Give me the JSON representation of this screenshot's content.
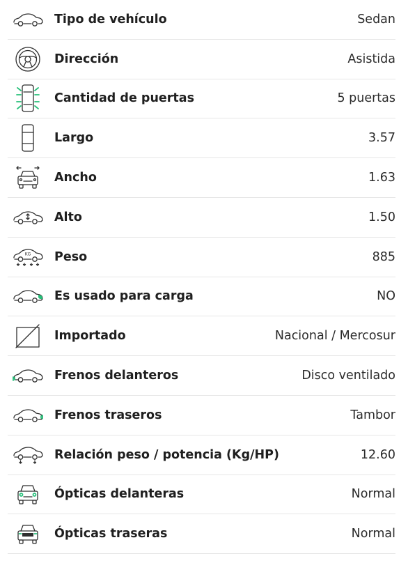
{
  "specs": [
    {
      "icon": "car-side-icon",
      "label": "Tipo de vehículo",
      "value": "Sedan"
    },
    {
      "icon": "steering-wheel-icon",
      "label": "Dirección",
      "value": "Asistida"
    },
    {
      "icon": "car-doors-icon",
      "label": "Cantidad de puertas",
      "value": "5 puertas"
    },
    {
      "icon": "car-length-icon",
      "label": "Largo",
      "value": "3.57"
    },
    {
      "icon": "car-width-icon",
      "label": "Ancho",
      "value": "1.63"
    },
    {
      "icon": "car-height-icon",
      "label": "Alto",
      "value": "1.50"
    },
    {
      "icon": "car-weight-icon",
      "label": "Peso",
      "value": "885",
      "icon_text": "KG"
    },
    {
      "icon": "car-cargo-icon",
      "label": "Es usado para carga",
      "value": "NO"
    },
    {
      "icon": "imported-crossed-icon",
      "label": "Importado",
      "value": "Nacional / Mercosur"
    },
    {
      "icon": "front-brakes-icon",
      "label": "Frenos delanteros",
      "value": "Disco ventilado"
    },
    {
      "icon": "rear-brakes-icon",
      "label": "Frenos traseros",
      "value": "Tambor"
    },
    {
      "icon": "weight-power-icon",
      "label": "Relación peso / potencia (Kg/HP)",
      "value": "12.60"
    },
    {
      "icon": "front-lights-icon",
      "label": "Ópticas delanteras",
      "value": "Normal"
    },
    {
      "icon": "rear-lights-icon",
      "label": "Ópticas traseras",
      "value": "Normal"
    }
  ],
  "colors": {
    "accent": "#27c07a",
    "text": "#1f1f1f",
    "divider": "#e6e6e6"
  }
}
